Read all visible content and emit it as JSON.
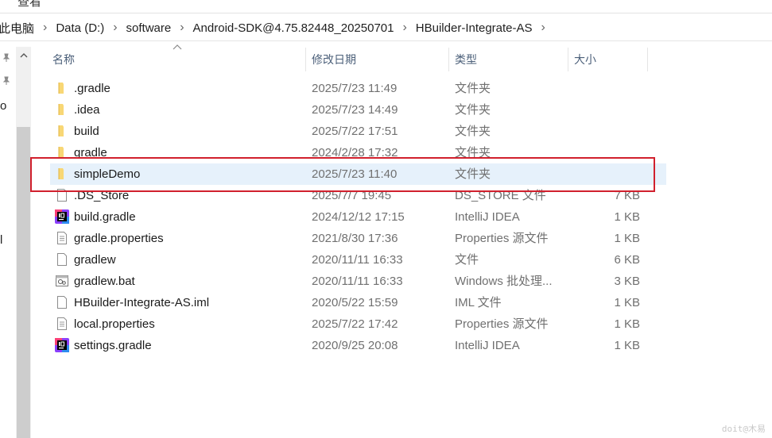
{
  "ribbon": {
    "visible_tab": "查看"
  },
  "breadcrumb": [
    "此电脑",
    "Data (D:)",
    "software",
    "Android-SDK@4.75.82448_20250701",
    "HBuilder-Integrate-AS"
  ],
  "nav_fragments": [
    "o",
    "l"
  ],
  "columns": {
    "name": "名称",
    "date": "修改日期",
    "type": "类型",
    "size": "大小"
  },
  "files": [
    {
      "name": ".gradle",
      "date": "2025/7/23 11:49",
      "type": "文件夹",
      "size": "",
      "icon": "folder-icon"
    },
    {
      "name": ".idea",
      "date": "2025/7/23 14:49",
      "type": "文件夹",
      "size": "",
      "icon": "folder-icon"
    },
    {
      "name": "build",
      "date": "2025/7/22 17:51",
      "type": "文件夹",
      "size": "",
      "icon": "folder-icon"
    },
    {
      "name": "gradle",
      "date": "2024/2/28 17:32",
      "type": "文件夹",
      "size": "",
      "icon": "folder-icon"
    },
    {
      "name": "simpleDemo",
      "date": "2025/7/23 11:40",
      "type": "文件夹",
      "size": "",
      "icon": "folder-icon",
      "selected": true
    },
    {
      "name": ".DS_Store",
      "date": "2025/7/7 19:45",
      "type": "DS_STORE 文件",
      "size": "7 KB",
      "icon": "file-icon"
    },
    {
      "name": "build.gradle",
      "date": "2024/12/12 17:15",
      "type": "IntelliJ IDEA",
      "size": "1 KB",
      "icon": "intellij-icon"
    },
    {
      "name": "gradle.properties",
      "date": "2021/8/30 17:36",
      "type": "Properties 源文件",
      "size": "1 KB",
      "icon": "text-file-icon"
    },
    {
      "name": "gradlew",
      "date": "2020/11/11 16:33",
      "type": "文件",
      "size": "6 KB",
      "icon": "file-icon"
    },
    {
      "name": "gradlew.bat",
      "date": "2020/11/11 16:33",
      "type": "Windows 批处理...",
      "size": "3 KB",
      "icon": "batch-file-icon"
    },
    {
      "name": "HBuilder-Integrate-AS.iml",
      "date": "2020/5/22 15:59",
      "type": "IML 文件",
      "size": "1 KB",
      "icon": "file-icon"
    },
    {
      "name": "local.properties",
      "date": "2025/7/22 17:42",
      "type": "Properties 源文件",
      "size": "1 KB",
      "icon": "text-file-icon"
    },
    {
      "name": "settings.gradle",
      "date": "2020/9/25 20:08",
      "type": "IntelliJ IDEA",
      "size": "1 KB",
      "icon": "intellij-icon"
    }
  ],
  "watermark": "doit@木易",
  "colors": {
    "highlight_border": "#d1202d",
    "selected_row": "#e6f1fb",
    "folder": "#f8d775"
  }
}
